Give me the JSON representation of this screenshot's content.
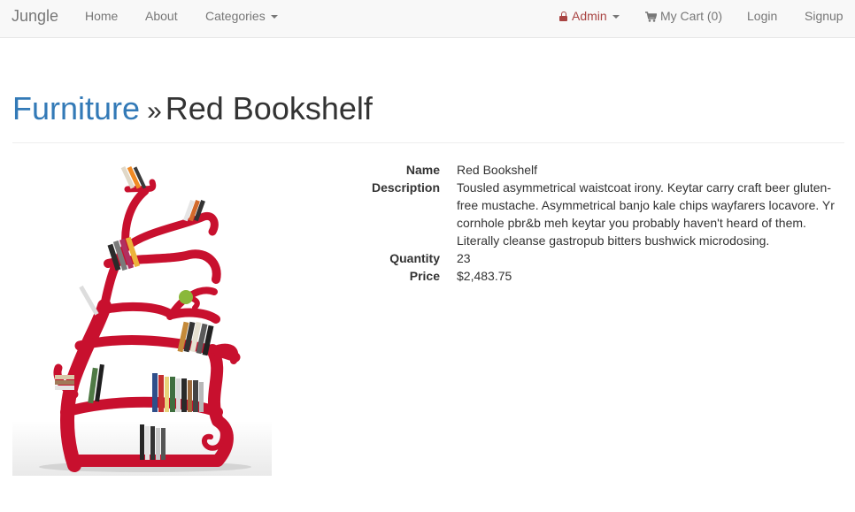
{
  "nav": {
    "brand": "Jungle",
    "home": "Home",
    "about": "About",
    "categories": "Categories",
    "admin": "Admin",
    "cart": "My Cart (0)",
    "login": "Login",
    "signup": "Signup"
  },
  "header": {
    "category": "Furniture",
    "separator": "»",
    "product": "Red Bookshelf"
  },
  "product": {
    "name_label": "Name",
    "name": "Red Bookshelf",
    "description_label": "Description",
    "description": "Tousled asymmetrical waistcoat irony. Keytar carry craft beer gluten-free mustache. Asymmetrical banjo kale chips wayfarers locavore. Yr cornhole pbr&b meh keytar you probably haven't heard of them. Literally cleanse gastropub bitters bushwick microdosing.",
    "quantity_label": "Quantity",
    "quantity": "23",
    "price_label": "Price",
    "price": "$2,483.75"
  },
  "colors": {
    "link": "#337ab7",
    "admin": "#a94442",
    "shelf": "#c8102e",
    "navbar_bg": "#f8f8f8"
  }
}
